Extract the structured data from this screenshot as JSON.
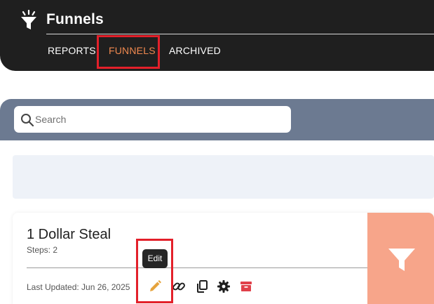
{
  "header": {
    "title": "Funnels",
    "brand_icon": "funnel-icon",
    "tabs": [
      {
        "label": "REPORTS",
        "active": false
      },
      {
        "label": "FUNNELS",
        "active": true
      },
      {
        "label": "ARCHIVED",
        "active": false
      }
    ]
  },
  "search": {
    "placeholder": "Search",
    "value": "",
    "icon": "search-icon"
  },
  "funnels": [
    {
      "title": "1 Dollar Steal",
      "steps": "Steps: 2",
      "last_updated": "Last Updated: Jun 26, 2025",
      "actions": [
        {
          "name": "edit",
          "icon": "pencil-icon",
          "color": "#e6a33c"
        },
        {
          "name": "link",
          "icon": "link-icon",
          "color": "#1f1f1f"
        },
        {
          "name": "copy",
          "icon": "copy-icon",
          "color": "#1f1f1f"
        },
        {
          "name": "settings",
          "icon": "gear-icon",
          "color": "#1f1f1f"
        },
        {
          "name": "archive",
          "icon": "archive-icon",
          "color": "#e0404a"
        }
      ],
      "tooltip": "Edit",
      "side_color": "#f7a58a"
    }
  ],
  "colors": {
    "header_bg": "#1f1f1f",
    "active_tab": "#f0894f",
    "search_band": "#6c7a91",
    "highlight": "#e3202a"
  }
}
